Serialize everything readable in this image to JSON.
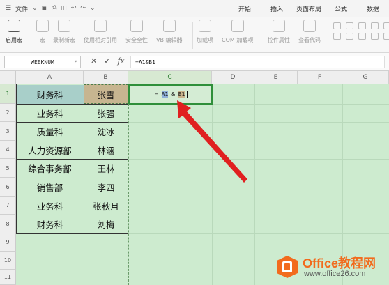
{
  "menubar": {
    "menu_label": "文件",
    "tabs": [
      "开始",
      "插入",
      "页面布局",
      "公式",
      "数据"
    ]
  },
  "ribbon": {
    "buttons": [
      {
        "label": "启用宏",
        "icon": "macro-enable-icon"
      },
      {
        "label": "宏",
        "icon": "macro-icon"
      },
      {
        "label": "录制新宏",
        "icon": "record-macro-icon"
      },
      {
        "label": "使用相对引用",
        "icon": "relative-reference-icon"
      },
      {
        "label": "安全全性",
        "icon": "macro-security-icon"
      },
      {
        "label": "VB 编辑器",
        "icon": "vb-editor-icon"
      },
      {
        "label": "加载项",
        "icon": "add-ins-icon"
      },
      {
        "label": "COM 加载项",
        "icon": "com-add-ins-icon"
      },
      {
        "label": "控件属性",
        "icon": "control-properties-icon"
      },
      {
        "label": "查看代码",
        "icon": "view-code-icon"
      }
    ]
  },
  "formula_bar": {
    "name_box": "WEEKNUM",
    "formula": "=A1&B1"
  },
  "sheet": {
    "columns": [
      "A",
      "B",
      "C",
      "D",
      "E",
      "F",
      "G"
    ],
    "rows": [
      "1",
      "2",
      "3",
      "4",
      "5",
      "6",
      "7",
      "8",
      "9",
      "10",
      "11"
    ],
    "cells": [
      [
        "财务科",
        "张雪"
      ],
      [
        "业务科",
        "张强"
      ],
      [
        "质量科",
        "沈冰"
      ],
      [
        "人力资源部",
        "林涵"
      ],
      [
        "综合事务部",
        "王林"
      ],
      [
        "销售部",
        "李四"
      ],
      [
        "业务科",
        "张秋月"
      ],
      [
        "财务科",
        "刘梅"
      ]
    ],
    "edit": {
      "eq": "= ",
      "ref1": "A1",
      "amp": " & ",
      "ref2": "B1"
    }
  },
  "watermark": {
    "brand": "Office教程网",
    "url": "www.office26.com"
  }
}
